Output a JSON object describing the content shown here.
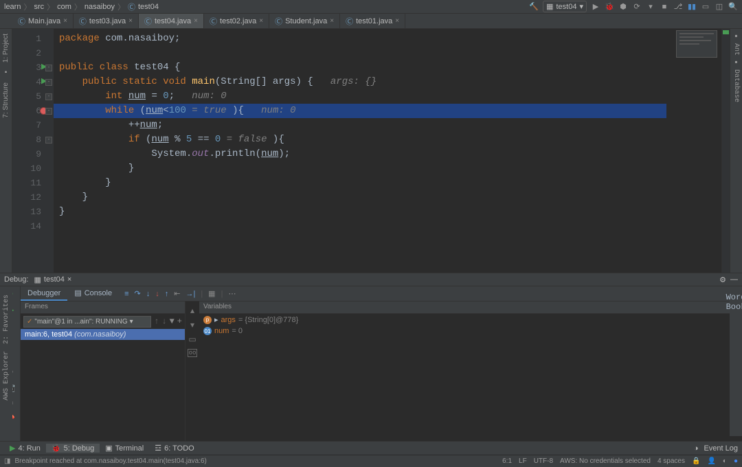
{
  "breadcrumb": {
    "p1": "learn",
    "p2": "src",
    "p3": "com",
    "p4": "nasaiboy",
    "file": "test04"
  },
  "run_config": "test04",
  "tabs": [
    {
      "label": "Main.java",
      "active": false
    },
    {
      "label": "test03.java",
      "active": false
    },
    {
      "label": "test04.java",
      "active": true
    },
    {
      "label": "test02.java",
      "active": false
    },
    {
      "label": "Student.java",
      "active": false
    },
    {
      "label": "test01.java",
      "active": false
    }
  ],
  "left_tools": {
    "project": "1: Project",
    "structure": "7: Structure"
  },
  "right_tools": {
    "ant": "Ant",
    "database": "Database",
    "wordbook": "Word Book"
  },
  "code": {
    "lines": [
      {
        "n": "1",
        "html": "<span class='kw'>package</span> com.nasaiboy;"
      },
      {
        "n": "2",
        "html": ""
      },
      {
        "n": "3",
        "html": "<span class='kw'>public class</span> <span class='id'>test04</span> {"
      },
      {
        "n": "4",
        "html": "    <span class='kw'>public static void</span> <span class='method'>main</span>(String[] args) {   <span class='com'>args: {}</span>"
      },
      {
        "n": "5",
        "html": "        <span class='kw'>int</span> <span class='underline'>num</span> = <span class='num'>0</span>;   <span class='com'>num: 0</span>"
      },
      {
        "n": "6",
        "html": "        <span class='kw'>while</span> (<span class='underline'>num</span>&lt;<span class='num'>100</span> <span class='com'>= true</span> ){   <span class='com'>num: 0</span>",
        "highlight": true
      },
      {
        "n": "7",
        "html": "            ++<span class='underline'>num</span>;"
      },
      {
        "n": "8",
        "html": "            <span class='kw'>if</span> (<span class='underline'>num</span> % <span class='num'>5</span> == <span class='num'>0</span> <span class='com'>= false</span> ){"
      },
      {
        "n": "9",
        "html": "                System.<span class='field'>out</span>.println(<span class='underline'>num</span>);"
      },
      {
        "n": "10",
        "html": "            }"
      },
      {
        "n": "11",
        "html": "        }"
      },
      {
        "n": "12",
        "html": "    }"
      },
      {
        "n": "13",
        "html": "}"
      },
      {
        "n": "14",
        "html": ""
      }
    ]
  },
  "debug": {
    "title": "Debug:",
    "config": "test04",
    "tabs": {
      "debugger": "Debugger",
      "console": "Console"
    },
    "frames": {
      "title": "Frames",
      "thread": "\"main\"@1 in ...ain\": RUNNING",
      "frame_label": "main:6, test04 ",
      "frame_pkg": "(com.nasaiboy)"
    },
    "variables": {
      "title": "Variables",
      "args_name": "args",
      "args_val": " = {String[0]@778}",
      "num_name": "num",
      "num_val": " = 0"
    }
  },
  "bottombar": {
    "run": "4: Run",
    "debug": "5: Debug",
    "terminal": "Terminal",
    "todo": "6: TODO",
    "eventlog": "Event Log"
  },
  "statusbar": {
    "msg": "Breakpoint reached at com.nasaiboy.test04.main(test04.java:6)",
    "pos": "6:1",
    "lf": "LF",
    "enc": "UTF-8",
    "aws": "AWS: No credentials selected",
    "indent": "4 spaces"
  },
  "aws_explorer": "AWS Explorer",
  "favorites": "2: Favorites"
}
